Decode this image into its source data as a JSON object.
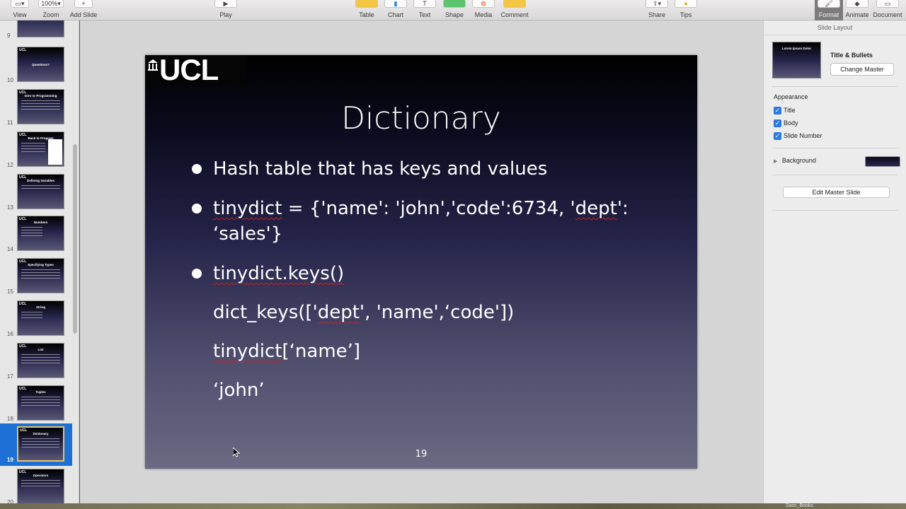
{
  "toolbar": {
    "view": "View",
    "zoom_value": "100%",
    "zoom": "Zoom",
    "add_slide": "Add Slide",
    "play": "Play",
    "table": "Table",
    "chart": "Chart",
    "text": "Text",
    "shape": "Shape",
    "media": "Media",
    "comment": "Comment",
    "share": "Share",
    "tips": "Tips",
    "format": "Format",
    "animate": "Animate",
    "document": "Document"
  },
  "navigator": {
    "slides": [
      {
        "num": "9",
        "title": ""
      },
      {
        "num": "10",
        "title": "Questions?"
      },
      {
        "num": "11",
        "title": "Intro to Programming"
      },
      {
        "num": "12",
        "title": "Back to Program"
      },
      {
        "num": "13",
        "title": "Defining Variables"
      },
      {
        "num": "14",
        "title": "Numbers"
      },
      {
        "num": "15",
        "title": "Specifying Types"
      },
      {
        "num": "16",
        "title": "String"
      },
      {
        "num": "17",
        "title": "List"
      },
      {
        "num": "18",
        "title": "Tuples"
      },
      {
        "num": "19",
        "title": "Dictionary"
      },
      {
        "num": "20",
        "title": "Operators"
      }
    ],
    "selected": "19"
  },
  "slide": {
    "logo": "UCL",
    "title": "Dictionary",
    "bullet1": "Hash table that has keys and values",
    "bullet2_a": "tinydict",
    "bullet2_b": " = {'name': 'john','code':6734, '",
    "bullet2_c": "dept",
    "bullet2_d": "':",
    "bullet2_line2": "‘sales'}",
    "bullet3": "tinydict.keys()",
    "line4_a": "dict_keys(['",
    "line4_b": "dept",
    "line4_c": "', 'name',‘code'])",
    "line5_a": "tinydict",
    "line5_b": "[‘name’]",
    "line6": "‘john’",
    "number": "19"
  },
  "inspector": {
    "header": "Slide Layout",
    "layout_thumb_title": "Lorem Ipsum Dolor",
    "layout_name": "Title & Bullets",
    "change_master": "Change Master",
    "appearance": "Appearance",
    "check_title": "Title",
    "check_body": "Body",
    "check_slide_number": "Slide Number",
    "background": "Background",
    "edit_master": "Edit Master Slide"
  },
  "desktop": {
    "dock_label": "Sass_Books"
  }
}
